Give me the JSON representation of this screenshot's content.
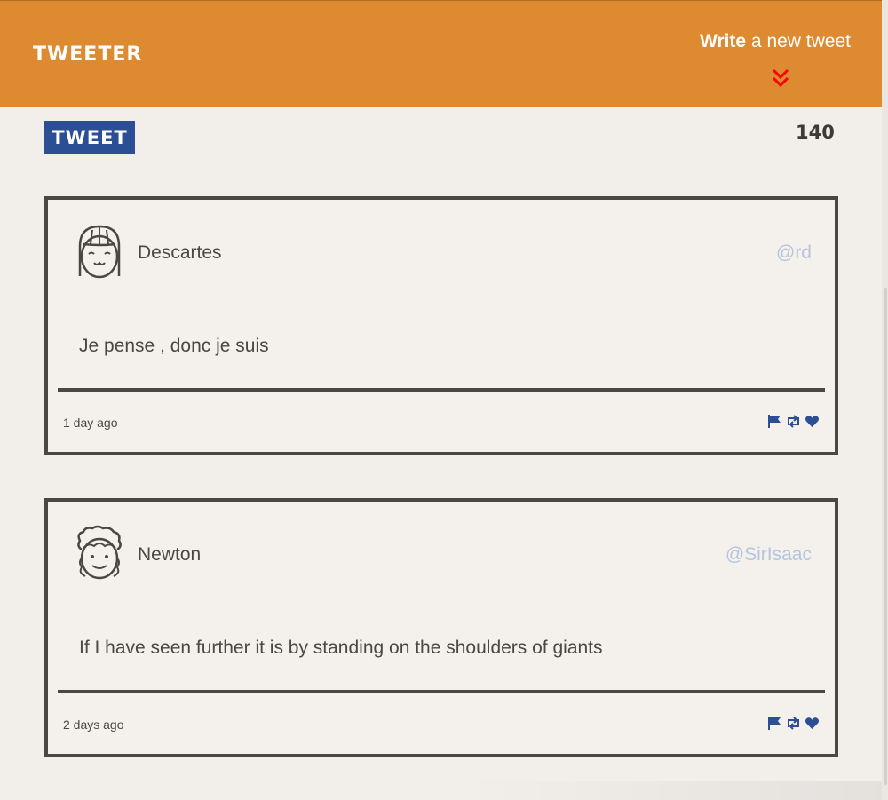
{
  "header": {
    "brand": "TWEETER",
    "compose_toggle": {
      "bold": "Write",
      "rest": " a new tweet"
    },
    "accent_color": "#dd8a31",
    "chevron_color": "#ff0000"
  },
  "composer": {
    "tweet_button_label": "TWEET",
    "char_counter": "140",
    "button_color": "#2b4e94"
  },
  "tweets": [
    {
      "name": "Descartes",
      "handle": "@rd",
      "content": "Je pense , donc je suis",
      "timestamp": "1 day ago",
      "avatar_icon": "girl-avatar-icon",
      "actions": [
        "flag-icon",
        "retweet-icon",
        "heart-icon"
      ]
    },
    {
      "name": "Newton",
      "handle": "@SirIsaac",
      "content": "If I have seen further it is by standing on the shoulders of giants",
      "timestamp": "2 days ago",
      "avatar_icon": "curly-hair-avatar-icon",
      "actions": [
        "flag-icon",
        "retweet-icon",
        "heart-icon"
      ]
    }
  ]
}
